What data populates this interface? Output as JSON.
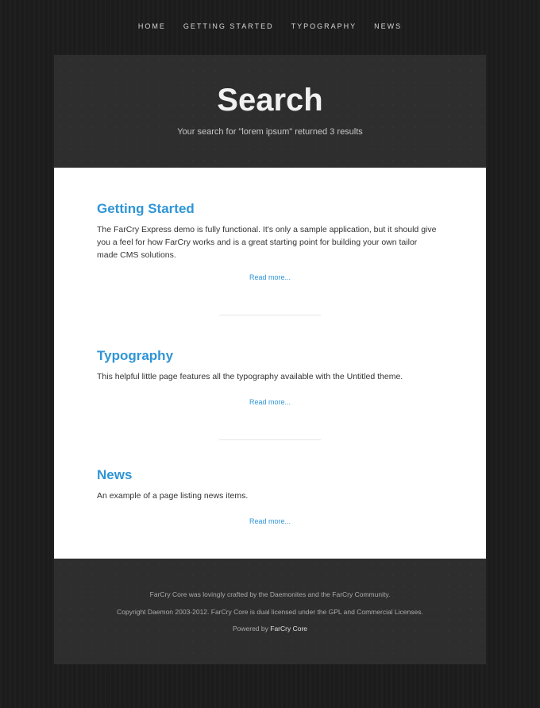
{
  "nav": {
    "items": [
      "HOME",
      "GETTING STARTED",
      "TYPOGRAPHY",
      "NEWS"
    ]
  },
  "hero": {
    "title": "Search",
    "subtitle": "Your search for \"lorem ipsum\" returned 3 results"
  },
  "results": [
    {
      "title": "Getting Started",
      "description": "The FarCry Express demo is fully functional. It's only a sample application, but it should give you a feel for how FarCry works and is a great starting point for building your own tailor made CMS solutions.",
      "read_more": "Read more..."
    },
    {
      "title": "Typography",
      "description": "This helpful little page features all the typography available with the Untitled theme.",
      "read_more": "Read more..."
    },
    {
      "title": "News",
      "description": "An example of a page listing news items.",
      "read_more": "Read more..."
    }
  ],
  "footer": {
    "line1": "FarCry Core was lovingly crafted by the Daemonites and the FarCry Community.",
    "line2": "Copyright Daemon 2003-2012. FarCry Core is dual licensed under the GPL and Commercial Licenses.",
    "powered_prefix": "Powered by",
    "powered_link": "FarCry Core"
  },
  "colors": {
    "background": "#1c1c1c",
    "panel": "#2e2e2e",
    "accent": "#2f95d6"
  }
}
